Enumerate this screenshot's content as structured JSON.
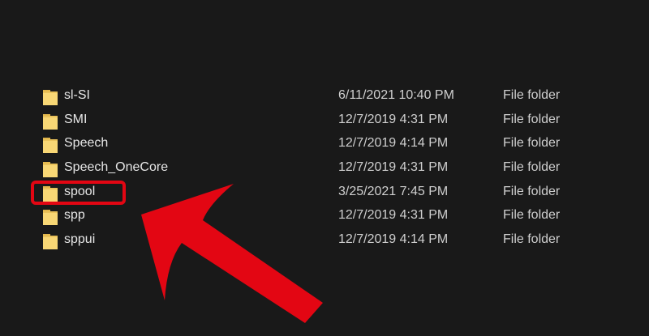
{
  "file_list": {
    "rows": [
      {
        "name": "sl-SI",
        "date": "6/11/2021 10:40 PM",
        "type": "File folder",
        "icon": "folder-icon"
      },
      {
        "name": "SMI",
        "date": "12/7/2019 4:31 PM",
        "type": "File folder",
        "icon": "folder-icon"
      },
      {
        "name": "Speech",
        "date": "12/7/2019 4:14 PM",
        "type": "File folder",
        "icon": "folder-icon"
      },
      {
        "name": "Speech_OneCore",
        "date": "12/7/2019 4:31 PM",
        "type": "File folder",
        "icon": "folder-icon"
      },
      {
        "name": "spool",
        "date": "3/25/2021 7:45 PM",
        "type": "File folder",
        "icon": "folder-icon"
      },
      {
        "name": "spp",
        "date": "12/7/2019 4:31 PM",
        "type": "File folder",
        "icon": "folder-icon"
      },
      {
        "name": "sppui",
        "date": "12/7/2019 4:14 PM",
        "type": "File folder",
        "icon": "folder-icon"
      }
    ]
  },
  "annotation": {
    "highlighted_item": "spool",
    "color": "#e30613"
  },
  "colors": {
    "background": "#191919",
    "folder_yellow": "#f8d775"
  }
}
